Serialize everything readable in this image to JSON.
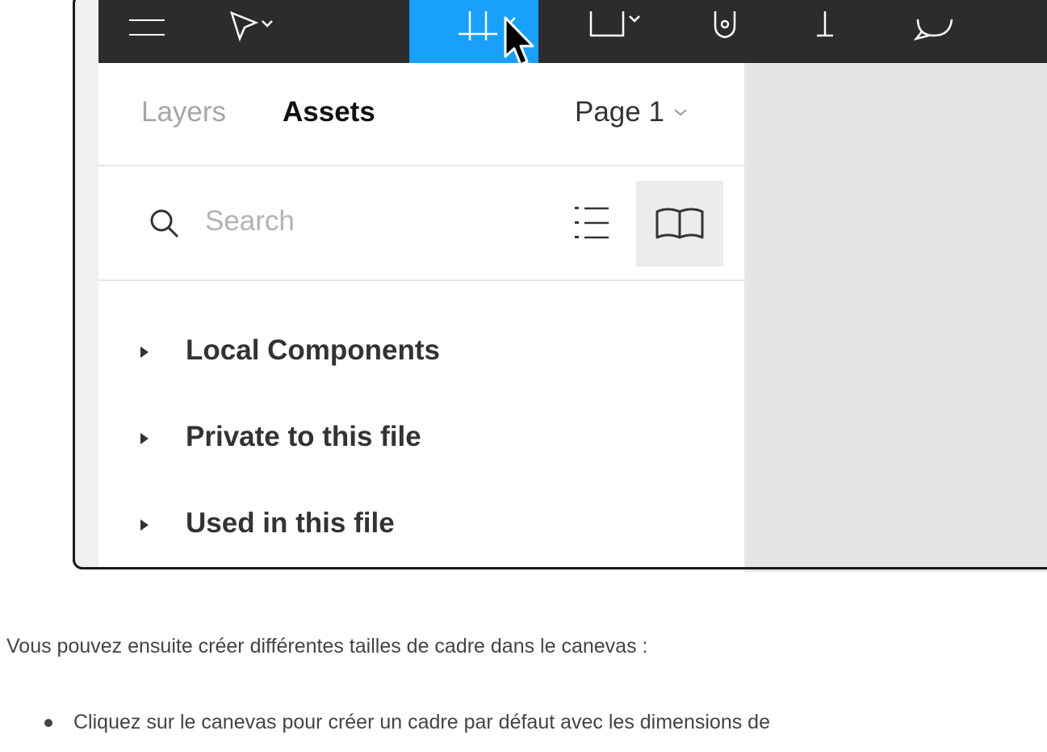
{
  "toolbar": {
    "tools": [
      {
        "name": "menu-icon"
      },
      {
        "name": "move-tool-icon"
      },
      {
        "name": "frame-tool-icon",
        "active": true
      },
      {
        "name": "shape-tool-icon"
      },
      {
        "name": "pen-tool-icon"
      },
      {
        "name": "text-tool-icon"
      },
      {
        "name": "comment-tool-icon"
      }
    ],
    "active_color": "#18a0fb"
  },
  "panel": {
    "tabs": [
      {
        "label": "Layers",
        "active": false
      },
      {
        "label": "Assets",
        "active": true
      }
    ],
    "page_select": "Page 1",
    "search": {
      "placeholder": "Search"
    },
    "sections": [
      {
        "label": "Local Components"
      },
      {
        "label": "Private to this file"
      },
      {
        "label": "Used in this file"
      }
    ]
  },
  "article": {
    "paragraph": "Vous pouvez ensuite créer différentes tailles de cadre dans le canevas :",
    "bullet": "Cliquez sur le canevas pour créer un cadre par défaut avec les dimensions de"
  }
}
